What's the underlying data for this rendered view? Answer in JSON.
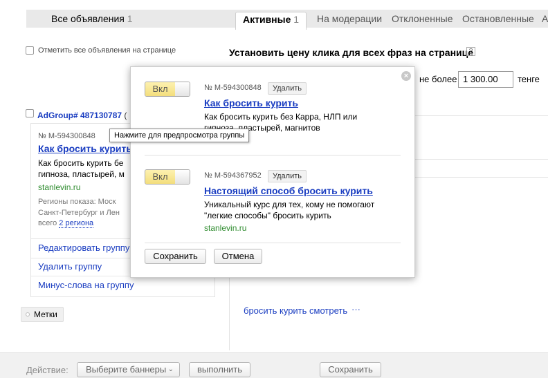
{
  "tabs": {
    "all_label": "Все объявления",
    "all_count": "1",
    "active_label": "Активные",
    "active_count": "1",
    "moderation": "На модерации",
    "rejected": "Отклоненные",
    "stopped": "Остановленные",
    "archive": "А"
  },
  "select_all_label": "Отметить все объявления на странице",
  "price": {
    "title": "Установить цену клика для всех фраз на странице",
    "help": "?",
    "prefix": "не более",
    "value": "1 300.00",
    "currency": "тенге"
  },
  "group": {
    "title": "AdGroup# 487130787",
    "title_tail": "(",
    "ad_num": "№ M-594300848",
    "ad_title": "Как бросить курить",
    "ad_text_1": "Как бросить курить бе",
    "ad_text_2": "гипноза, пластырей, м",
    "domain": "stanlevin.ru",
    "regions_1": "Регионы показа: Моск",
    "regions_2": "Санкт-Петербург и Лен",
    "regions_total_prefix": "всего",
    "regions_link": "2 региона",
    "edit_link": "Редактировать группу",
    "delete_link": "Удалить группу",
    "minus_words_link": "Минус-слова на группу"
  },
  "tags_button": "Метки",
  "tooltip": "Нажмите для предпросмотра группы",
  "phrase_link": "бросить курить смотреть",
  "phrase_more": "···",
  "popup": {
    "ads": [
      {
        "toggle": "Вкл",
        "num": "№ M-594300848",
        "delete": "Удалить",
        "title": "Как бросить курить",
        "text_1": "Как бросить курить без Карра, НЛП или",
        "text_2": "гипноза, пластырей, магнитов",
        "domain": "stanlevin.ru"
      },
      {
        "toggle": "Вкл",
        "num": "№ M-594367952",
        "delete": "Удалить",
        "title": "Настоящий способ бросить курить",
        "text_1": "Уникальный курс для тех, кому не помогают",
        "text_2": "\"легкие способы\" бросить курить",
        "domain": "stanlevin.ru"
      }
    ],
    "save": "Сохранить",
    "cancel": "Отмена"
  },
  "bottom": {
    "action_label": "Действие:",
    "select_value": "Выберите баннеры",
    "execute": "выполнить",
    "save": "Сохранить"
  }
}
